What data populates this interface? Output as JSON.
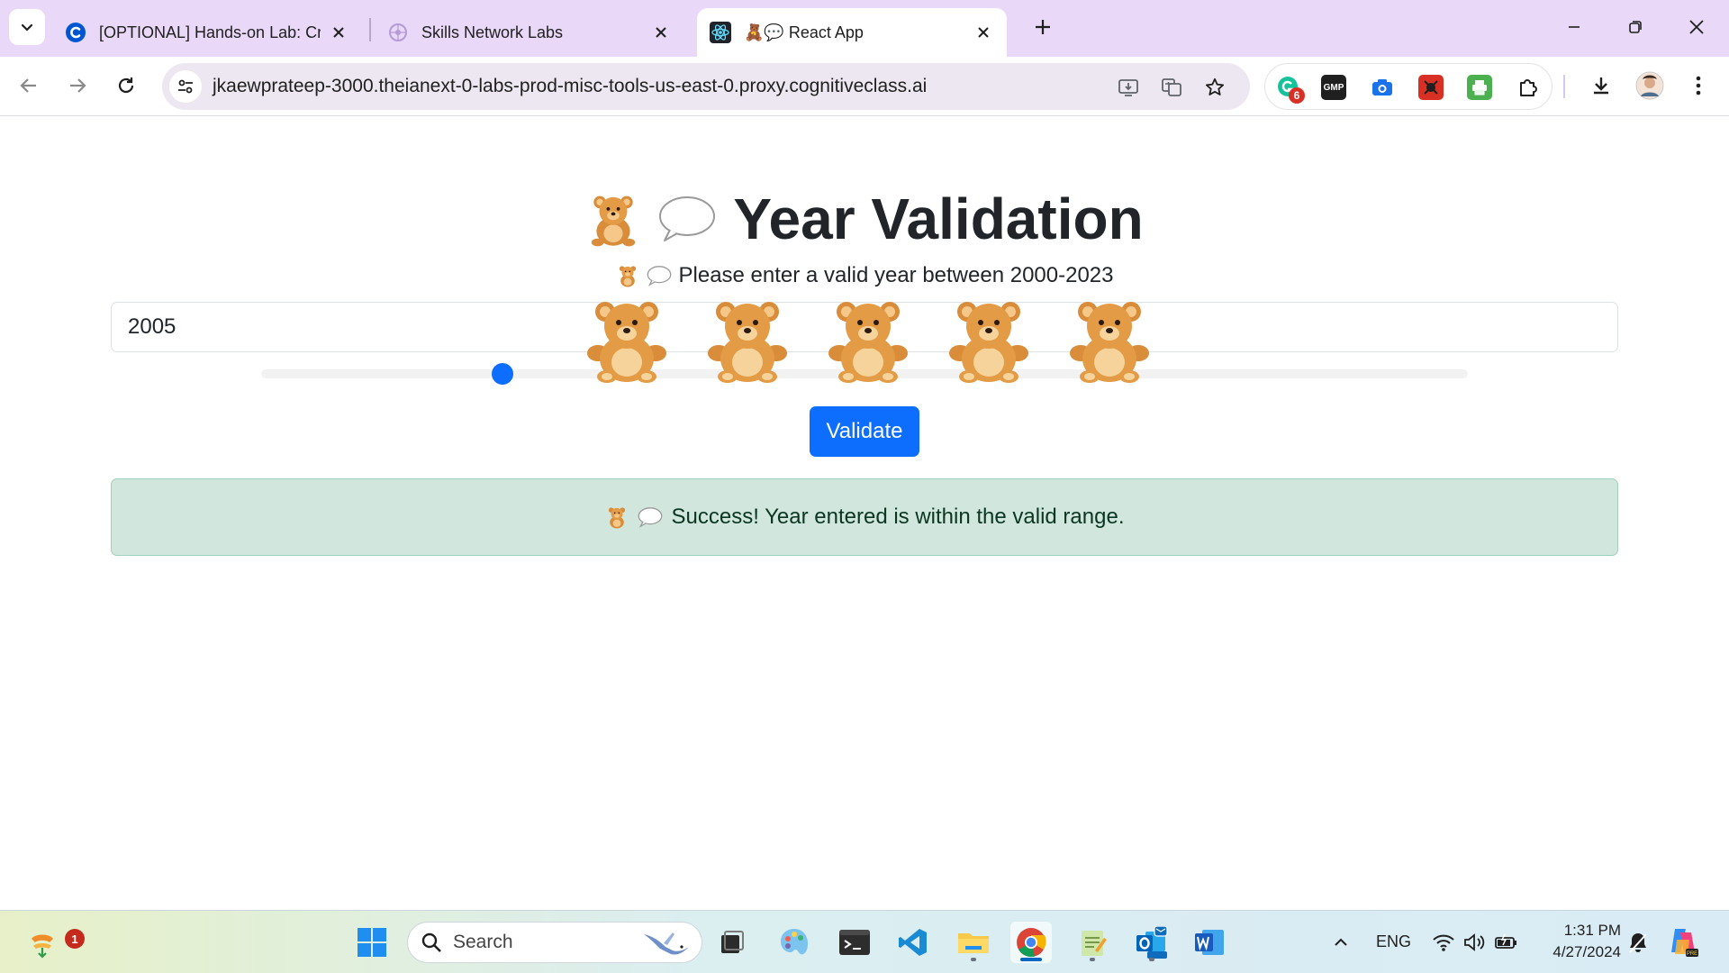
{
  "browser": {
    "tabs": [
      {
        "label": "[OPTIONAL] Hands-on Lab: Cre",
        "favicon": "coursera-c-icon",
        "active": false
      },
      {
        "label": "Skills Network Labs",
        "favicon": "skills-network-icon",
        "active": false
      },
      {
        "label": "🧸💬 React App",
        "favicon": "react-icon",
        "active": true
      }
    ],
    "address_bar": {
      "url": "jkaewprateep-3000.theianext-0-labs-prod-misc-tools-us-east-0.proxy.cognitiveclass.ai"
    },
    "extensions": [
      {
        "name": "grammarly-icon",
        "badge": "6",
        "color": "#15c39a"
      },
      {
        "name": "gmp-icon",
        "text": "GMP",
        "color": "#1f1f1f"
      },
      {
        "name": "camera-icon",
        "color": "#1a73e8"
      },
      {
        "name": "red-extension-icon",
        "color": "#d93025"
      },
      {
        "name": "printer-icon",
        "color": "#4caf50"
      },
      {
        "name": "puzzle-icon",
        "color": "#1f1f1f"
      }
    ]
  },
  "page": {
    "title": "Year Validation",
    "subtitle": "Please enter a valid year between 2000-2023",
    "year_input_value": "2005",
    "slider_level_fraction": 0.2,
    "bear_count": 5,
    "validate_label": "Validate",
    "alert_message": "Success! Year entered is within the valid range.",
    "colors": {
      "primary": "#0d6efd",
      "success_bg": "#d1e7dd",
      "success_text": "#0a3622"
    }
  },
  "taskbar": {
    "search_placeholder": "Search",
    "notification_count": "1",
    "language": "ENG",
    "time": "1:31 PM",
    "date": "4/27/2024"
  }
}
